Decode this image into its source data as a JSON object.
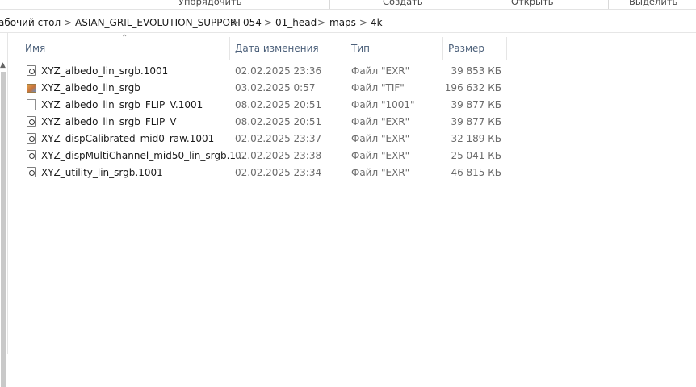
{
  "ribbon": {
    "groups": [
      "Упорядочить",
      "Создать",
      "Открыть",
      "Выделить"
    ]
  },
  "address": {
    "crumbs": [
      "абочий стол",
      "ASIAN_GRIL_EVOLUTION_SUPPORT",
      "054",
      "01_head",
      "maps",
      "4k"
    ],
    "separator": ">"
  },
  "columns": {
    "name": "Имя",
    "date": "Дата изменения",
    "type": "Тип",
    "size": "Размер"
  },
  "files": [
    {
      "name": "XYZ_albedo_lin_srgb.1001",
      "date": "02.02.2025 23:36",
      "type": "Файл \"EXR\"",
      "size": "39 853 КБ",
      "icon": "exr-file-icon"
    },
    {
      "name": "XYZ_albedo_lin_srgb",
      "date": "03.02.2025 0:57",
      "type": "Файл \"TIF\"",
      "size": "196 632 КБ",
      "icon": "tif-image-icon"
    },
    {
      "name": "XYZ_albedo_lin_srgb_FLIP_V.1001",
      "date": "08.02.2025 20:51",
      "type": "Файл \"1001\"",
      "size": "39 877 КБ",
      "icon": "blank-file-icon"
    },
    {
      "name": "XYZ_albedo_lin_srgb_FLIP_V",
      "date": "08.02.2025 20:51",
      "type": "Файл \"EXR\"",
      "size": "39 877 КБ",
      "icon": "exr-file-icon"
    },
    {
      "name": "XYZ_dispCalibrated_mid0_raw.1001",
      "date": "02.02.2025 23:37",
      "type": "Файл \"EXR\"",
      "size": "32 189 КБ",
      "icon": "exr-file-icon"
    },
    {
      "name": "XYZ_dispMultiChannel_mid50_lin_srgb.1...",
      "date": "02.02.2025 23:38",
      "type": "Файл \"EXR\"",
      "size": "25 041 КБ",
      "icon": "exr-file-icon"
    },
    {
      "name": "XYZ_utility_lin_srgb.1001",
      "date": "02.02.2025 23:34",
      "type": "Файл \"EXR\"",
      "size": "46 815 КБ",
      "icon": "exr-file-icon"
    }
  ]
}
